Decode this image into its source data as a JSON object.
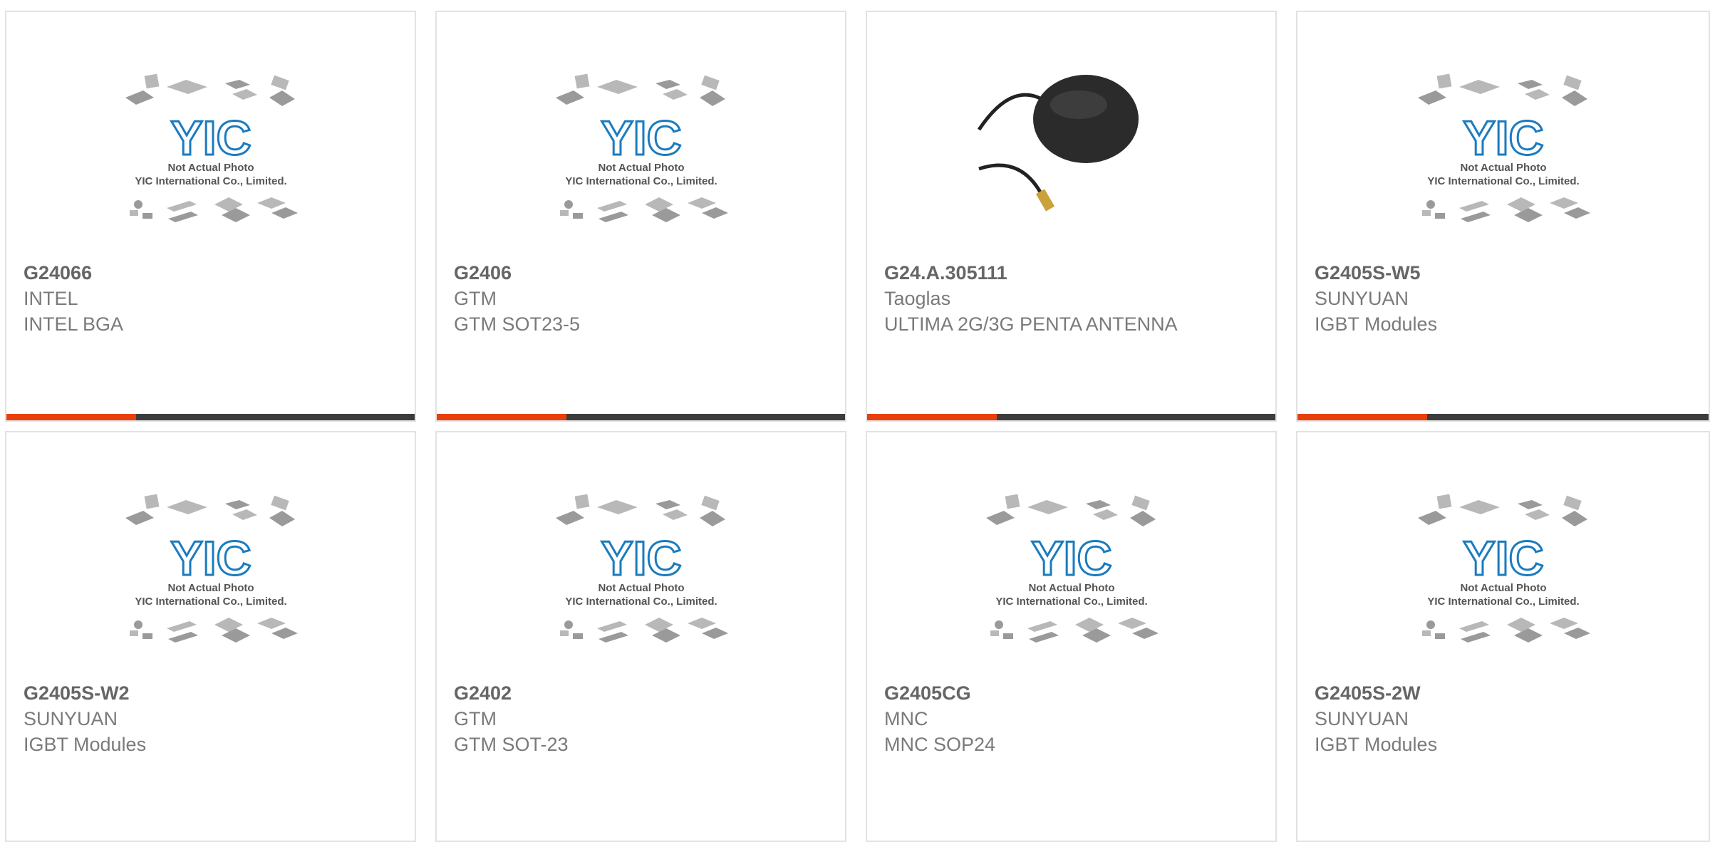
{
  "products": [
    {
      "part_number": "G24066",
      "manufacturer": "INTEL",
      "description": "INTEL BGA",
      "image": "placeholder",
      "image_caption_1": "Not Actual Photo",
      "image_caption_2": "YIC International Co., Limited.",
      "image_logo": "YIC"
    },
    {
      "part_number": "G2406",
      "manufacturer": "GTM",
      "description": "GTM SOT23-5",
      "image": "placeholder",
      "image_caption_1": "Not Actual Photo",
      "image_caption_2": "YIC International Co., Limited.",
      "image_logo": "YIC"
    },
    {
      "part_number": "G24.A.305111",
      "manufacturer": "Taoglas",
      "description": "ULTIMA 2G/3G PENTA ANTENNA",
      "image": "antenna-photo"
    },
    {
      "part_number": "G2405S-W5",
      "manufacturer": "SUNYUAN",
      "description": "IGBT Modules",
      "image": "placeholder",
      "image_caption_1": "Not Actual Photo",
      "image_caption_2": "YIC International Co., Limited.",
      "image_logo": "YIC"
    },
    {
      "part_number": "G2405S-W2",
      "manufacturer": "SUNYUAN",
      "description": "IGBT Modules",
      "image": "placeholder",
      "image_caption_1": "Not Actual Photo",
      "image_caption_2": "YIC International Co., Limited.",
      "image_logo": "YIC"
    },
    {
      "part_number": "G2402",
      "manufacturer": "GTM",
      "description": "GTM SOT-23",
      "image": "placeholder",
      "image_caption_1": "Not Actual Photo",
      "image_caption_2": "YIC International Co., Limited.",
      "image_logo": "YIC"
    },
    {
      "part_number": "G2405CG",
      "manufacturer": "MNC",
      "description": "MNC SOP24",
      "image": "placeholder",
      "image_caption_1": "Not Actual Photo",
      "image_caption_2": "YIC International Co., Limited.",
      "image_logo": "YIC"
    },
    {
      "part_number": "G2405S-2W",
      "manufacturer": "SUNYUAN",
      "description": "IGBT Modules",
      "image": "placeholder",
      "image_caption_1": "Not Actual Photo",
      "image_caption_2": "YIC International Co., Limited.",
      "image_logo": "YIC"
    }
  ],
  "colors": {
    "accent": "#e8400c",
    "bar": "#3c3c3c",
    "border": "#e2e2e2",
    "logo": "#1a7bbf",
    "part_number": "#666666",
    "text": "#7a7a7a"
  }
}
